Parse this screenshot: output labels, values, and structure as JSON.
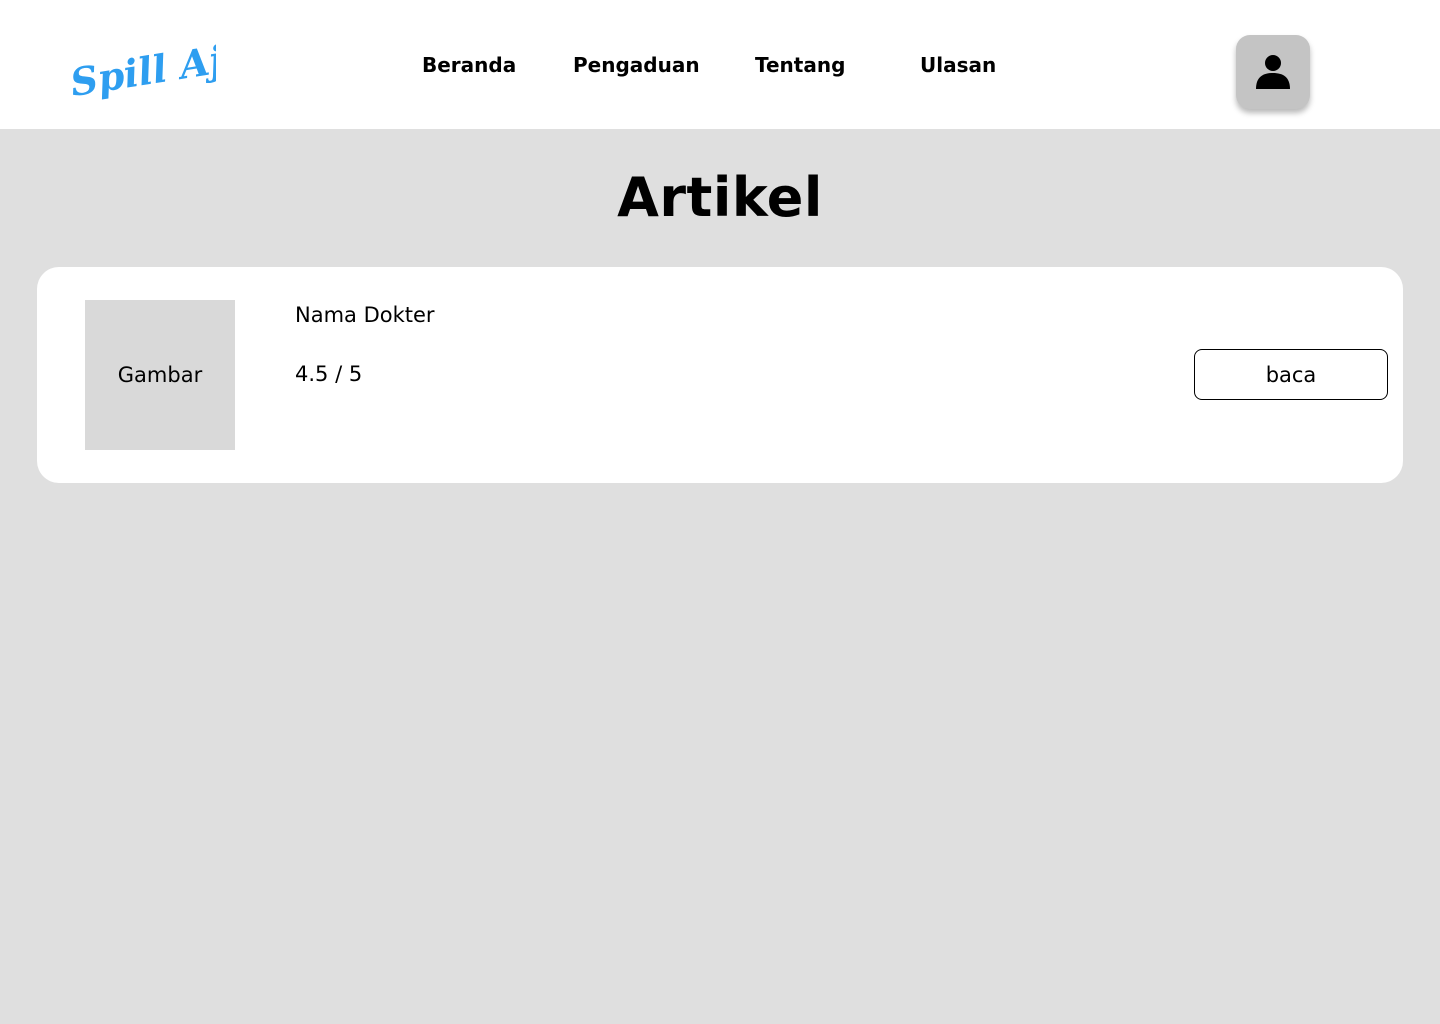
{
  "header": {
    "logo_text": "Spill Aja",
    "brand_color": "#2e9ef0",
    "nav": [
      {
        "label": "Beranda"
      },
      {
        "label": "Pengaduan"
      },
      {
        "label": "Tentang"
      },
      {
        "label": "Ulasan"
      }
    ],
    "profile_icon": "user-icon"
  },
  "main": {
    "title": "Artikel",
    "cards": [
      {
        "image_placeholder": "Gambar",
        "name": "Nama Dokter",
        "rating": "4.5 / 5",
        "action_label": "baca"
      }
    ]
  },
  "colors": {
    "page_background": "#dfdfdf",
    "header_background": "#ffffff",
    "card_background": "#ffffff",
    "thumbnail_background": "#d9d9d9",
    "profile_button_background": "#c4c4c4"
  }
}
